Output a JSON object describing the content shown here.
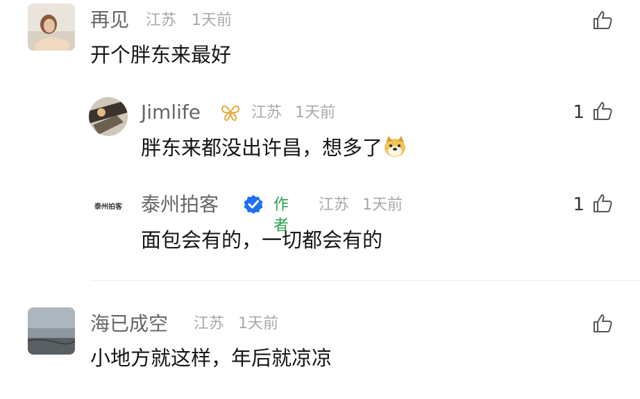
{
  "comments": [
    {
      "username": "再见",
      "location": "江苏",
      "time": "1天前",
      "text": "开个胖东来最好",
      "like_count": ""
    },
    {
      "username": "Jimlife",
      "location": "江苏",
      "time": "1天前",
      "text": "胖东来都没出许昌，想多了",
      "emoji": "doge-emoji",
      "like_count": "1"
    },
    {
      "username": "泰州拍客",
      "avatar_text": "泰州拍客",
      "badge": "作者",
      "location": "江苏",
      "time": "1天前",
      "text": "面包会有的，一切都会有的",
      "like_count": "1"
    },
    {
      "username": "海已成空",
      "location": "江苏",
      "time": "1天前",
      "text": "小地方就这样，年后就凉凉",
      "like_count": ""
    }
  ],
  "colors": {
    "username": "#666666",
    "meta": "#a8a8a8",
    "author_badge": "#2ba24c",
    "verified": "#1f6ff2"
  }
}
